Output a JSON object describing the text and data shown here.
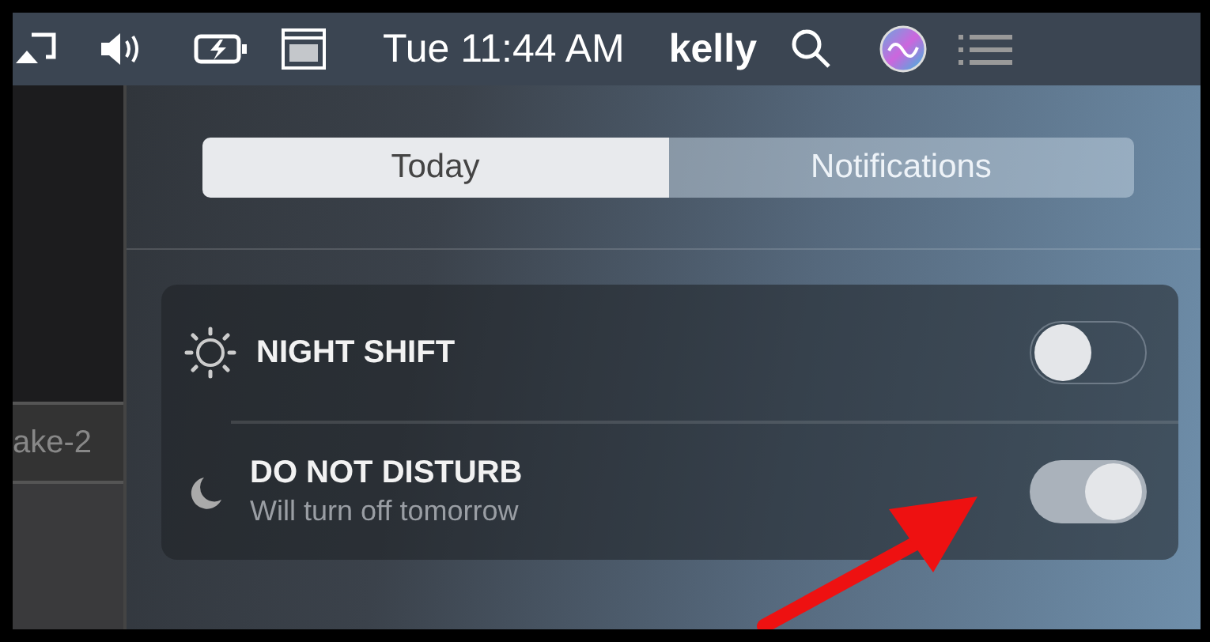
{
  "menu_bar": {
    "clock": "Tue 11:44 AM",
    "user": "kelly"
  },
  "background_window": {
    "label": "ake-2"
  },
  "tabs": [
    {
      "label": "Today",
      "selected": true
    },
    {
      "label": "Notifications",
      "selected": false
    }
  ],
  "settings": [
    {
      "kind": "sun",
      "label": "NIGHT SHIFT",
      "on": false
    },
    {
      "kind": "moon",
      "label": "DO NOT DISTURB",
      "detail": "Will turn off tomorrow",
      "on": true
    }
  ]
}
